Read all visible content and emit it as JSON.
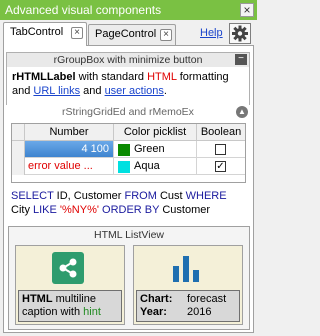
{
  "window": {
    "title": "Advanced visual components",
    "close_glyph": "×"
  },
  "tabs": [
    {
      "label": "TabControl",
      "active": true
    },
    {
      "label": "PageControl",
      "active": false
    }
  ],
  "help_link": "Help",
  "group1": {
    "header": "rGroupBox with minimize button",
    "label_bold": "rHTMLLabel",
    "label_with": " with standard ",
    "label_html": "HTML",
    "label_fmt": " formatting",
    "label_and": "and ",
    "label_url": "URL links",
    "label_and2": " and ",
    "label_actions": "user actions",
    "label_end": "."
  },
  "group2": {
    "header": "rStringGridEd and rMemoEx",
    "grid": {
      "columns": [
        "Number",
        "Color picklist",
        "Boolean"
      ],
      "rows": [
        {
          "number": "4 100",
          "color_name": "Green",
          "color_hex": "#0a8a00",
          "checked": false
        },
        {
          "number": "error value ...",
          "color_name": "Aqua",
          "color_hex": "#00e0e0",
          "checked": true
        }
      ]
    },
    "memo": {
      "kw_select": "SELECT",
      "fields": " ID, Customer ",
      "kw_from": "FROM",
      "table": " Cust ",
      "kw_where": "WHERE",
      "field2": "City ",
      "kw_like": "LIKE",
      "literal": " '%NY%' ",
      "kw_order": "ORDER BY",
      "field3": " Customer"
    }
  },
  "listview": {
    "header": "HTML ListView",
    "item1": {
      "icon": "share-icon",
      "cap_bold": "HTML",
      "cap_rest": " multiline",
      "cap_line2": "caption with ",
      "cap_hint": "hint",
      "icon_color": "#2e9c6e"
    },
    "item2": {
      "icon": "bar-chart-icon",
      "chart_label": "Chart:",
      "chart_value": "forecast",
      "year_label": "Year:",
      "year_value": "2016",
      "icon_color": "#1f6fb0"
    }
  }
}
